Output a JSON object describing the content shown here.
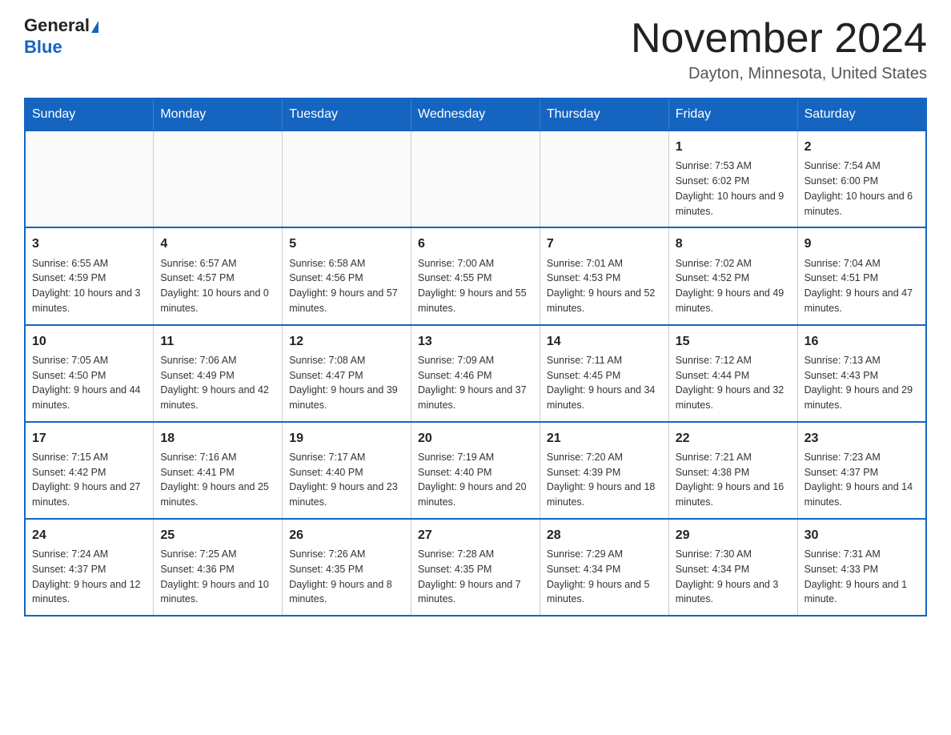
{
  "header": {
    "logo_general": "General",
    "logo_blue": "Blue",
    "title": "November 2024",
    "subtitle": "Dayton, Minnesota, United States"
  },
  "weekdays": [
    "Sunday",
    "Monday",
    "Tuesday",
    "Wednesday",
    "Thursday",
    "Friday",
    "Saturday"
  ],
  "weeks": [
    [
      {
        "day": "",
        "info": ""
      },
      {
        "day": "",
        "info": ""
      },
      {
        "day": "",
        "info": ""
      },
      {
        "day": "",
        "info": ""
      },
      {
        "day": "",
        "info": ""
      },
      {
        "day": "1",
        "info": "Sunrise: 7:53 AM\nSunset: 6:02 PM\nDaylight: 10 hours and 9 minutes."
      },
      {
        "day": "2",
        "info": "Sunrise: 7:54 AM\nSunset: 6:00 PM\nDaylight: 10 hours and 6 minutes."
      }
    ],
    [
      {
        "day": "3",
        "info": "Sunrise: 6:55 AM\nSunset: 4:59 PM\nDaylight: 10 hours and 3 minutes."
      },
      {
        "day": "4",
        "info": "Sunrise: 6:57 AM\nSunset: 4:57 PM\nDaylight: 10 hours and 0 minutes."
      },
      {
        "day": "5",
        "info": "Sunrise: 6:58 AM\nSunset: 4:56 PM\nDaylight: 9 hours and 57 minutes."
      },
      {
        "day": "6",
        "info": "Sunrise: 7:00 AM\nSunset: 4:55 PM\nDaylight: 9 hours and 55 minutes."
      },
      {
        "day": "7",
        "info": "Sunrise: 7:01 AM\nSunset: 4:53 PM\nDaylight: 9 hours and 52 minutes."
      },
      {
        "day": "8",
        "info": "Sunrise: 7:02 AM\nSunset: 4:52 PM\nDaylight: 9 hours and 49 minutes."
      },
      {
        "day": "9",
        "info": "Sunrise: 7:04 AM\nSunset: 4:51 PM\nDaylight: 9 hours and 47 minutes."
      }
    ],
    [
      {
        "day": "10",
        "info": "Sunrise: 7:05 AM\nSunset: 4:50 PM\nDaylight: 9 hours and 44 minutes."
      },
      {
        "day": "11",
        "info": "Sunrise: 7:06 AM\nSunset: 4:49 PM\nDaylight: 9 hours and 42 minutes."
      },
      {
        "day": "12",
        "info": "Sunrise: 7:08 AM\nSunset: 4:47 PM\nDaylight: 9 hours and 39 minutes."
      },
      {
        "day": "13",
        "info": "Sunrise: 7:09 AM\nSunset: 4:46 PM\nDaylight: 9 hours and 37 minutes."
      },
      {
        "day": "14",
        "info": "Sunrise: 7:11 AM\nSunset: 4:45 PM\nDaylight: 9 hours and 34 minutes."
      },
      {
        "day": "15",
        "info": "Sunrise: 7:12 AM\nSunset: 4:44 PM\nDaylight: 9 hours and 32 minutes."
      },
      {
        "day": "16",
        "info": "Sunrise: 7:13 AM\nSunset: 4:43 PM\nDaylight: 9 hours and 29 minutes."
      }
    ],
    [
      {
        "day": "17",
        "info": "Sunrise: 7:15 AM\nSunset: 4:42 PM\nDaylight: 9 hours and 27 minutes."
      },
      {
        "day": "18",
        "info": "Sunrise: 7:16 AM\nSunset: 4:41 PM\nDaylight: 9 hours and 25 minutes."
      },
      {
        "day": "19",
        "info": "Sunrise: 7:17 AM\nSunset: 4:40 PM\nDaylight: 9 hours and 23 minutes."
      },
      {
        "day": "20",
        "info": "Sunrise: 7:19 AM\nSunset: 4:40 PM\nDaylight: 9 hours and 20 minutes."
      },
      {
        "day": "21",
        "info": "Sunrise: 7:20 AM\nSunset: 4:39 PM\nDaylight: 9 hours and 18 minutes."
      },
      {
        "day": "22",
        "info": "Sunrise: 7:21 AM\nSunset: 4:38 PM\nDaylight: 9 hours and 16 minutes."
      },
      {
        "day": "23",
        "info": "Sunrise: 7:23 AM\nSunset: 4:37 PM\nDaylight: 9 hours and 14 minutes."
      }
    ],
    [
      {
        "day": "24",
        "info": "Sunrise: 7:24 AM\nSunset: 4:37 PM\nDaylight: 9 hours and 12 minutes."
      },
      {
        "day": "25",
        "info": "Sunrise: 7:25 AM\nSunset: 4:36 PM\nDaylight: 9 hours and 10 minutes."
      },
      {
        "day": "26",
        "info": "Sunrise: 7:26 AM\nSunset: 4:35 PM\nDaylight: 9 hours and 8 minutes."
      },
      {
        "day": "27",
        "info": "Sunrise: 7:28 AM\nSunset: 4:35 PM\nDaylight: 9 hours and 7 minutes."
      },
      {
        "day": "28",
        "info": "Sunrise: 7:29 AM\nSunset: 4:34 PM\nDaylight: 9 hours and 5 minutes."
      },
      {
        "day": "29",
        "info": "Sunrise: 7:30 AM\nSunset: 4:34 PM\nDaylight: 9 hours and 3 minutes."
      },
      {
        "day": "30",
        "info": "Sunrise: 7:31 AM\nSunset: 4:33 PM\nDaylight: 9 hours and 1 minute."
      }
    ]
  ]
}
